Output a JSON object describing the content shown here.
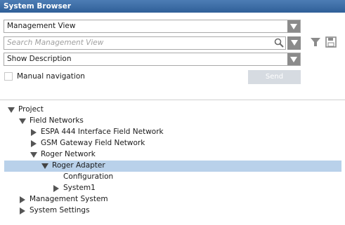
{
  "window": {
    "title": "System Browser"
  },
  "view_select": {
    "value": "Management View"
  },
  "search": {
    "placeholder": "Search Management View"
  },
  "description_select": {
    "value": "Show Description"
  },
  "manual_navigation": {
    "label": "Manual navigation",
    "checked": false
  },
  "send_button": {
    "label": "Send"
  },
  "tree": {
    "root": "Project",
    "field_networks": "Field Networks",
    "espa": "ESPA 444 Interface Field Network",
    "gsm": "GSM Gateway Field Network",
    "roger_network": "Roger Network",
    "roger_adapter": "Roger Adapter",
    "configuration": "Configuration",
    "system1": "System1",
    "management_system": "Management System",
    "system_settings": "System Settings"
  },
  "colors": {
    "title_bar": "#3a6aa5",
    "selection": "#b9d1ea",
    "button_gray": "#8b8b8b"
  }
}
